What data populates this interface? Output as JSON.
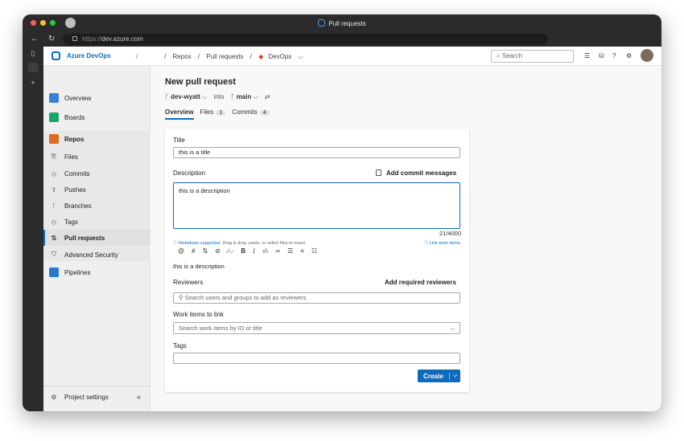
{
  "window": {
    "title": "Pull requests",
    "url_prefix": "https://",
    "url_host": "dev.azure.com"
  },
  "topbar": {
    "org": "Azure DevOps",
    "sep1": "/",
    "sep2": "/",
    "crumbs": [
      "Repos",
      "/",
      "Pull requests",
      "/"
    ],
    "repo": "DevOps",
    "repo_chevron": "⌵",
    "search_placeholder": "Search"
  },
  "sidebar": {
    "items": [
      {
        "label": "Overview",
        "color": "#3a7fd6"
      },
      {
        "label": "Boards",
        "color": "#1aa36a"
      },
      {
        "label": "Repos",
        "color": "#e06b1f"
      }
    ],
    "repo_sub": [
      {
        "label": "Files",
        "icon": "⎘"
      },
      {
        "label": "Commits",
        "icon": "◇"
      },
      {
        "label": "Pushes",
        "icon": "⇪"
      },
      {
        "label": "Branches",
        "icon": "ᚴ"
      },
      {
        "label": "Tags",
        "icon": "◇"
      },
      {
        "label": "Pull requests",
        "icon": "⇅"
      },
      {
        "label": "Advanced Security",
        "icon": "⛉"
      }
    ],
    "pipelines": "Pipelines",
    "settings": "Project settings",
    "collapse": "«"
  },
  "pr": {
    "title": "New pull request",
    "source_branch": "dev-wyatt",
    "into": "into",
    "target_branch": "main",
    "swap": "⇄",
    "tabs": [
      {
        "label": "Overview"
      },
      {
        "label": "Files",
        "count": "1"
      },
      {
        "label": "Commits",
        "count": "4"
      }
    ]
  },
  "form": {
    "title_label": "Title",
    "title_value": "this is a title",
    "description_label": "Description",
    "add_commit_messages": "Add commit messages",
    "description_value": "this is a description",
    "counter": "21/4000",
    "hint_link": "Markdown supported.",
    "hint_text": " Drag & drop, paste, or select files to insert.",
    "link_work_items": "Link work items.",
    "preview": "this is a description",
    "reviewers_label": "Reviewers",
    "add_required_reviewers": "Add required reviewers",
    "reviewers_placeholder": "Search users and groups to add as reviewers",
    "work_items_label": "Work items to link",
    "work_items_placeholder": "Search work items by ID or title",
    "tags_label": "Tags",
    "create_label": "Create"
  },
  "colors": {
    "accent": "#0f6cbd"
  }
}
